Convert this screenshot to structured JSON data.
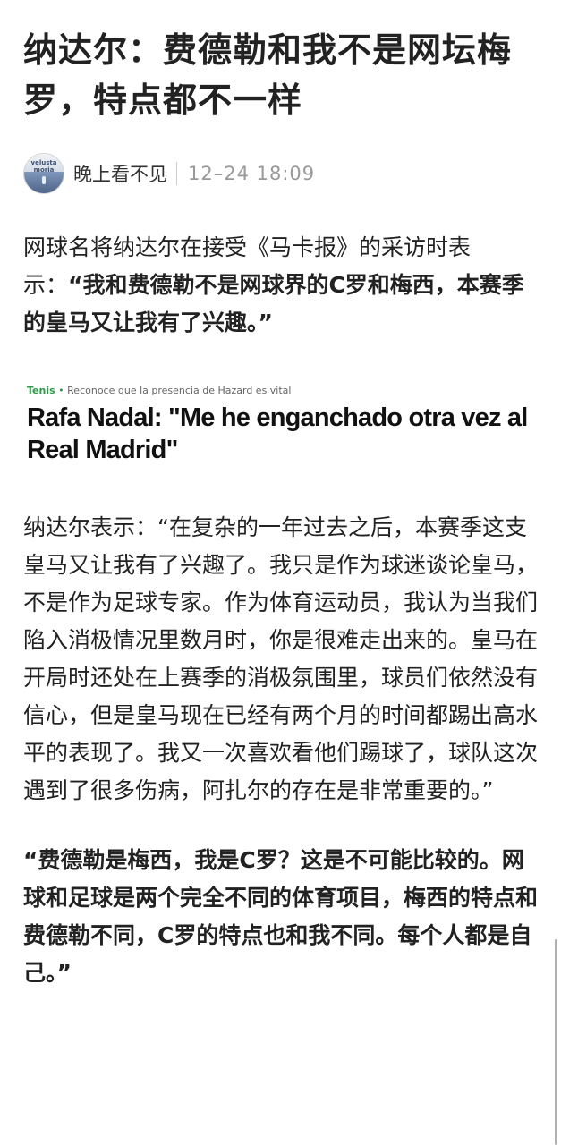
{
  "article": {
    "title": "纳达尔：费德勒和我不是网坛梅罗，特点都不一样",
    "author": {
      "avatar_text": "velusta moria",
      "name": "晚上看不见",
      "time": "12–24 18:09"
    },
    "intro_normal": "网球名将纳达尔在接受《马卡报》的采访时表示：",
    "intro_bold": "“我和费德勒不是网球界的C罗和梅西，本赛季的皇马又让我有了兴趣。”",
    "embed": {
      "category": "Tenis",
      "bullet": "•",
      "kicker": "Reconoce que la presencia de Hazard es vital",
      "headline": "Rafa Nadal: \"Me he enganchado otra vez al Real Madrid\""
    },
    "para2": "纳达尔表示：“在复杂的一年过去之后，本赛季这支皇马又让我有了兴趣了。我只是作为球迷谈论皇马，不是作为足球专家。作为体育运动员，我认为当我们陷入消极情况里数月时，你是很难走出来的。皇马在开局时还处在上赛季的消极氛围里，球员们依然没有信心，但是皇马现在已经有两个月的时间都踢出高水平的表现了。我又一次喜欢看他们踢球了，球队这次遇到了很多伤病，阿扎尔的存在是非常重要的。”",
    "para3": "“费德勒是梅西，我是C罗？这是不可能比较的。网球和足球是两个完全不同的体育项目，梅西的特点和费德勒不同，C罗的特点也和我不同。每个人都是自己。”"
  },
  "colors": {
    "text": "#222222",
    "meta_time": "#999999",
    "embed_category": "#2e9b4a"
  },
  "icons": {
    "avatar": "user-avatar-image"
  }
}
